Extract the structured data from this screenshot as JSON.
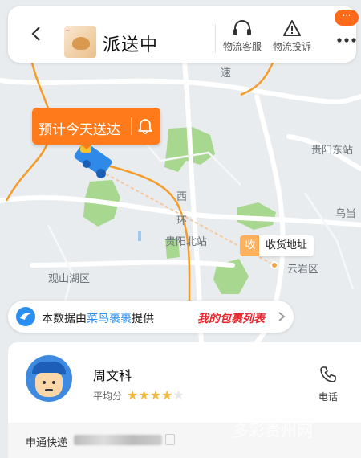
{
  "header": {
    "title": "派送中",
    "actions": [
      {
        "label": "物流客服",
        "icon": "headset-icon"
      },
      {
        "label": "物流投诉",
        "icon": "warning-icon"
      }
    ],
    "badge": "···",
    "thumb_text": "..."
  },
  "map": {
    "labels": [
      {
        "key": "su",
        "text": "速"
      },
      {
        "key": "guiyang_east",
        "text": "贵阳东站"
      },
      {
        "key": "xi",
        "text": "西"
      },
      {
        "key": "huan",
        "text": "环"
      },
      {
        "key": "guiyang_north",
        "text": "贵阳北站"
      },
      {
        "key": "wudang",
        "text": "乌当"
      },
      {
        "key": "guanshanhu",
        "text": "观山湖区"
      },
      {
        "key": "yunyan",
        "text": "云岩区"
      }
    ],
    "eta": "预计今天送达",
    "receive_icon": "收",
    "receive_label": "收货地址"
  },
  "banner": {
    "prefix": "本数据由",
    "provider": "菜鸟裹裹",
    "suffix": "提供",
    "link": "我的包裹列表"
  },
  "courier": {
    "name": "周文科",
    "rating_label": "平均分",
    "rating": 4,
    "rating_max": 5,
    "phone_label": "电话"
  },
  "waybill": {
    "company": "申通快递"
  },
  "watermark": "多彩贵州网",
  "colors": {
    "accent": "#ff7a1a",
    "cainiao_blue": "#2a8ff0",
    "red_link": "#e8262d",
    "star": "#f6b93b"
  }
}
